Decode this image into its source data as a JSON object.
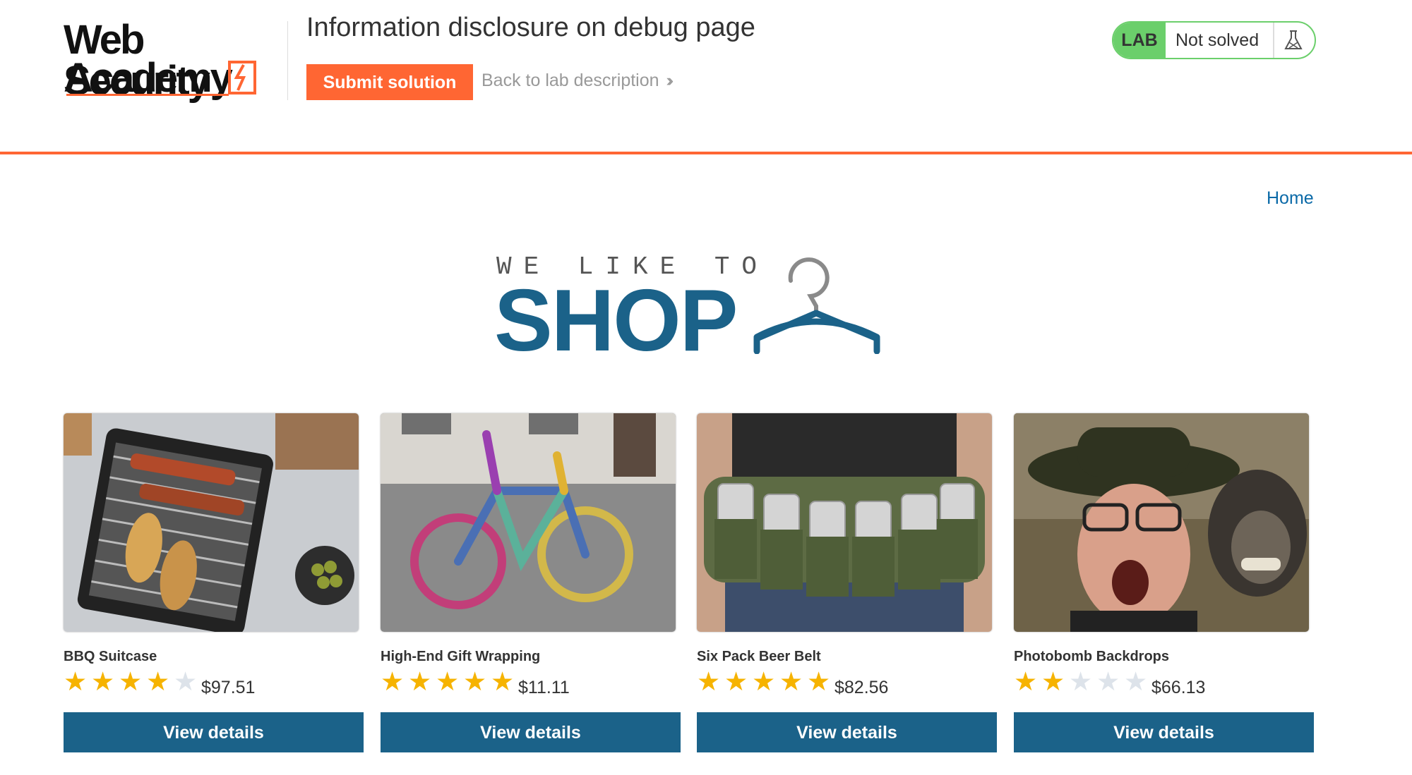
{
  "header": {
    "logo": {
      "line1": "Web Security",
      "line2": "Academy"
    },
    "lab_title": "Information disclosure on debug page",
    "submit_label": "Submit solution",
    "back_label": "Back to lab description",
    "status": {
      "badge": "LAB",
      "text": "Not solved",
      "icon": "flask-icon"
    }
  },
  "nav": {
    "home": "Home"
  },
  "banner": {
    "subtitle": "WE LIKE TO",
    "title": "SHOP",
    "icon": "hanger-icon"
  },
  "products": [
    {
      "name": "BBQ Suitcase",
      "rating": 4,
      "price": "$97.51",
      "button": "View details"
    },
    {
      "name": "High-End Gift Wrapping",
      "rating": 5,
      "price": "$11.11",
      "button": "View details"
    },
    {
      "name": "Six Pack Beer Belt",
      "rating": 5,
      "price": "$82.56",
      "button": "View details"
    },
    {
      "name": "Photobomb Backdrops",
      "rating": 2,
      "price": "$66.13",
      "button": "View details"
    }
  ],
  "colors": {
    "accent": "#ff6633",
    "primary": "#1b6289",
    "solved_badge": "#6bcf6b",
    "star": "#f6b300",
    "link": "#0b6aa8"
  }
}
